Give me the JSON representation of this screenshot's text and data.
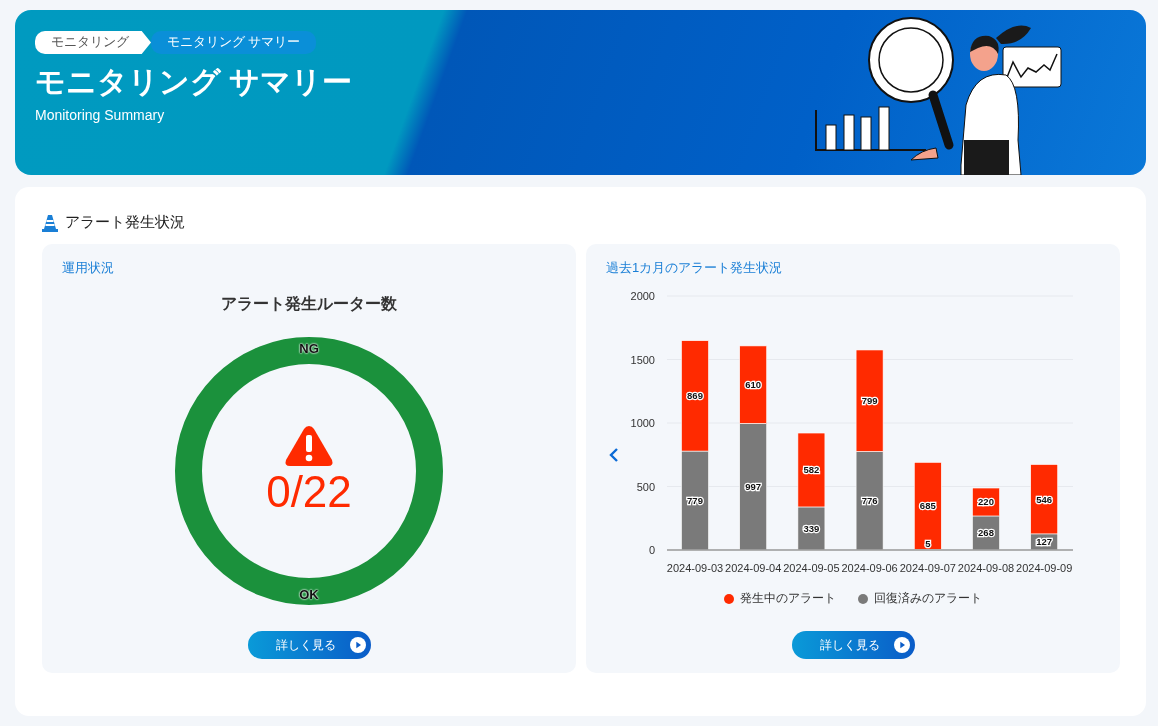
{
  "header": {
    "breadcrumbs": [
      {
        "label": "モニタリング",
        "selected": false
      },
      {
        "label": "モニタリング サマリー",
        "selected": true
      }
    ],
    "title": "モニタリング サマリー",
    "subtitle": "Monitoring Summary"
  },
  "section": {
    "title": "アラート発生状況"
  },
  "status_panel": {
    "title": "運用状況",
    "heading": "アラート発生ルーター数",
    "ring_top_label": "NG",
    "ring_bottom_label": "OK",
    "count": "0/22",
    "button": "詳しく見る"
  },
  "chart_panel": {
    "title": "過去1カ月のアラート発生状況",
    "button": "詳しく見る",
    "chart_data": {
      "type": "bar",
      "stacked": true,
      "data_labels": true,
      "categories": [
        "2024-09-03",
        "2024-09-04",
        "2024-09-05",
        "2024-09-06",
        "2024-09-07",
        "2024-09-08",
        "2024-09-09"
      ],
      "series": [
        {
          "name": "回復済みのアラート",
          "color": "#7a7a7a",
          "values": [
            779,
            997,
            339,
            776,
            5,
            268,
            127
          ]
        },
        {
          "name": "発生中のアラート",
          "color": "#ff2a00",
          "values": [
            869,
            610,
            582,
            799,
            685,
            220,
            546
          ]
        }
      ],
      "ylim": [
        0,
        2000
      ],
      "grid": true,
      "yticks": [
        0,
        500,
        1000,
        1500,
        2000
      ]
    }
  }
}
